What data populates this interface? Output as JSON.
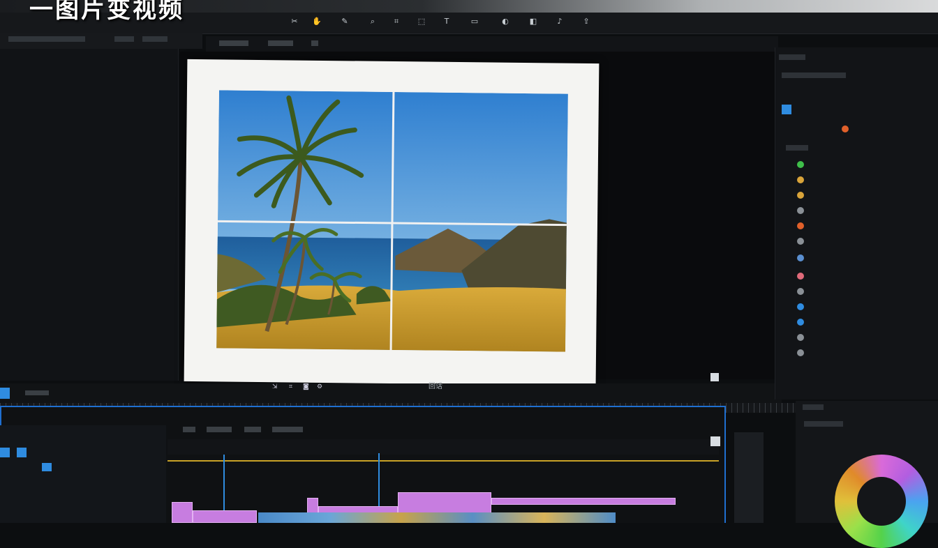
{
  "caption": "一图片变视频",
  "window": {
    "title": ""
  },
  "viewer": {
    "bottom_label": "回话",
    "bottom_icons": [
      "export-icon",
      "crop-icon",
      "camera-icon",
      "settings-icon"
    ]
  },
  "toolbar": {
    "icons": [
      "cut-icon",
      "hand-icon",
      "pen-icon",
      "zoom-icon",
      "crop-icon",
      "transform-icon",
      "text-icon",
      "shape-icon",
      "mask-icon",
      "color-icon",
      "audio-icon",
      "export-icon"
    ]
  },
  "colors": {
    "accent": "#1f6fd0",
    "clip": "#c77de0",
    "playhead": "#c9a227"
  },
  "timeline": {
    "tabs": [
      "",
      "",
      "",
      "",
      "",
      ""
    ]
  },
  "right_panel": {
    "layer_dot_colors": [
      "#3fbf4a",
      "#d9a43a",
      "#d9a43a",
      "#8a9096",
      "#e0602a",
      "#8a9096",
      "#5a8fd0",
      "#e06a7a",
      "#8a9096",
      "#2f8ce0",
      "#2f8ce0",
      "#8a9096",
      "#8a9096"
    ]
  }
}
